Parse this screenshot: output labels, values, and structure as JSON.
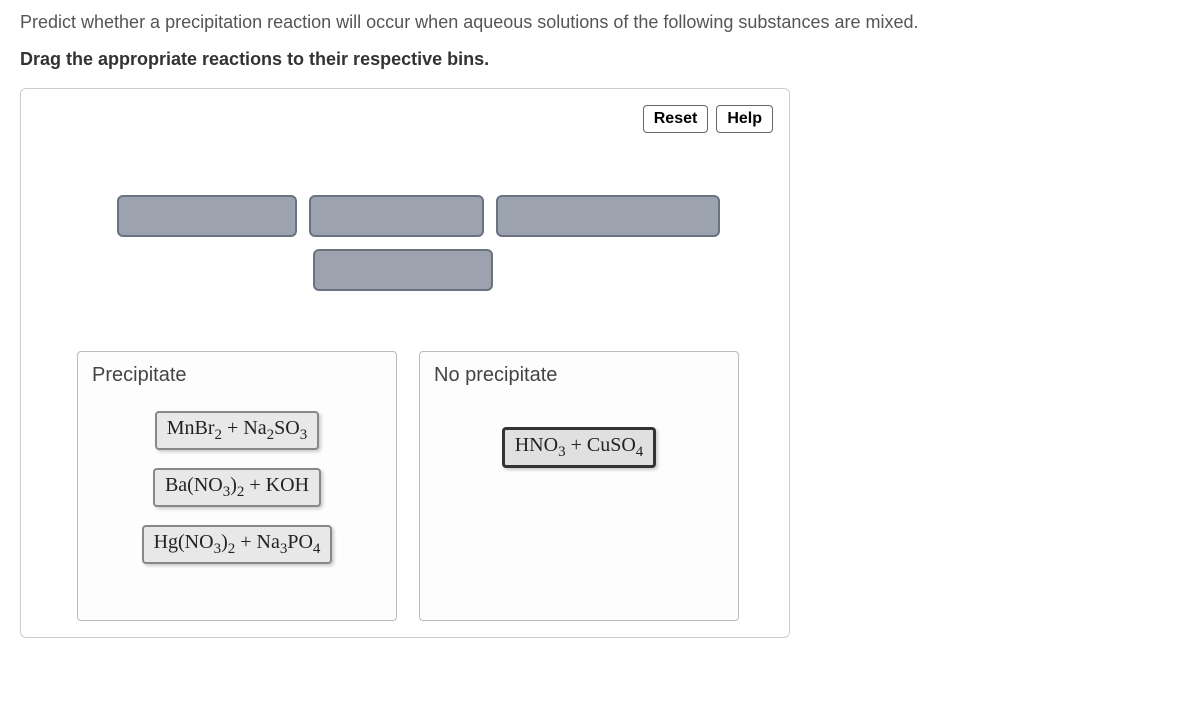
{
  "question": "Predict whether a precipitation reaction will occur when aqueous solutions of the following substances are mixed.",
  "instruction": "Drag the appropriate reactions to their respective bins.",
  "buttons": {
    "reset": "Reset",
    "help": "Help"
  },
  "bins": {
    "precipitate": {
      "title": "Precipitate",
      "items": [
        {
          "html": "MnBr<sub>2</sub> + Na<sub>2</sub>SO<sub>3</sub>"
        },
        {
          "html": "Ba(NO<sub>3</sub>)<sub>2</sub> + KOH"
        },
        {
          "html": "Hg(NO<sub>3</sub>)<sub>2</sub> + Na<sub>3</sub>PO<sub>4</sub>"
        }
      ]
    },
    "no_precipitate": {
      "title": "No precipitate",
      "items": [
        {
          "html": "HNO<sub>3</sub> + CuSO<sub>4</sub>",
          "selected": true
        }
      ]
    }
  }
}
